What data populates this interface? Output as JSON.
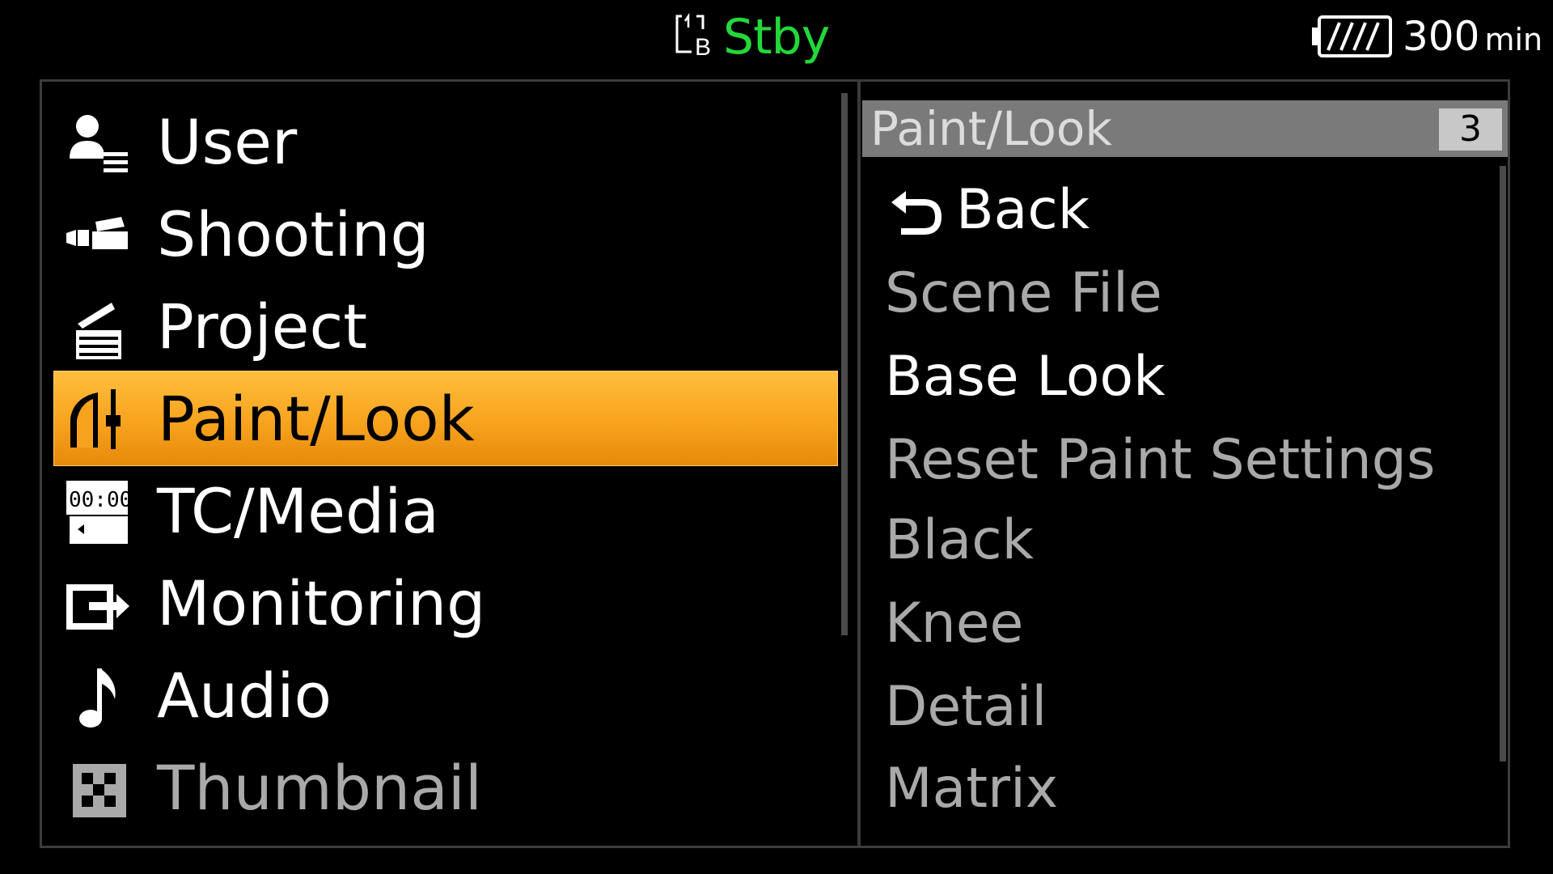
{
  "status": {
    "slot_label": "B",
    "mode": "Stby",
    "battery_remaining": "300",
    "battery_unit": "min"
  },
  "menu": {
    "items": [
      {
        "label": "User",
        "icon": "user-icon",
        "state": "normal"
      },
      {
        "label": "Shooting",
        "icon": "camera-icon",
        "state": "normal"
      },
      {
        "label": "Project",
        "icon": "clapperboard-icon",
        "state": "normal"
      },
      {
        "label": "Paint/Look",
        "icon": "paint-look-icon",
        "state": "selected"
      },
      {
        "label": "TC/Media",
        "icon": "timecode-icon",
        "state": "normal"
      },
      {
        "label": "Monitoring",
        "icon": "monitor-output-icon",
        "state": "normal"
      },
      {
        "label": "Audio",
        "icon": "music-note-icon",
        "state": "normal"
      },
      {
        "label": "Thumbnail",
        "icon": "thumbnail-icon",
        "state": "disabled"
      }
    ],
    "tc_icon_text": "00:00"
  },
  "submenu": {
    "title": "Paint/Look",
    "page": "3",
    "items": [
      {
        "label": "Back",
        "state": "enabled"
      },
      {
        "label": "Scene File",
        "state": "disabled"
      },
      {
        "label": "Base Look",
        "state": "enabled"
      },
      {
        "label": "Reset Paint Settings",
        "state": "disabled"
      },
      {
        "label": "Black",
        "state": "disabled"
      },
      {
        "label": "Knee",
        "state": "disabled"
      },
      {
        "label": "Detail",
        "state": "disabled"
      },
      {
        "label": "Matrix",
        "state": "disabled"
      }
    ]
  },
  "colors": {
    "standby": "#22d83a",
    "selection": "#f7a31e",
    "disabled_text": "#a9a9a9"
  }
}
